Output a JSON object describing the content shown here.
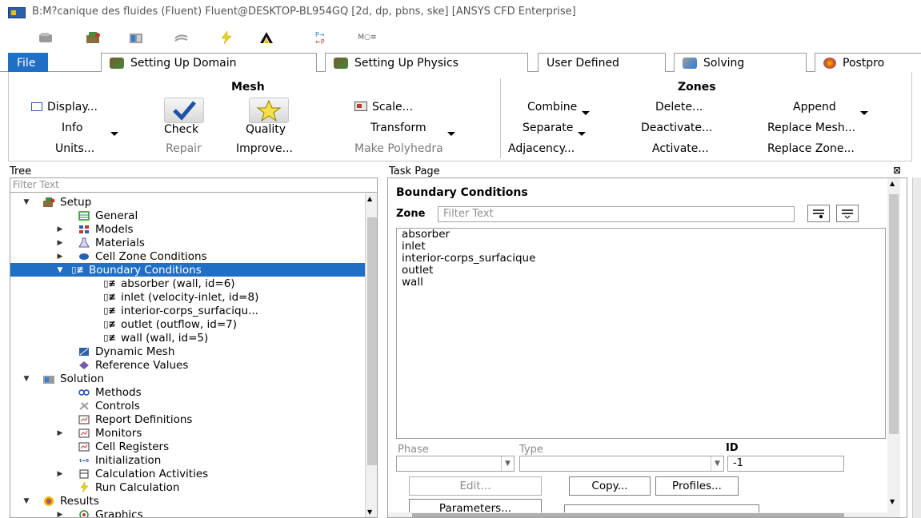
{
  "window": {
    "title": "B:M?canique des fluides (Fluent) Fluent@DESKTOP-BL954GQ  [2d, dp, pbns, ske] [ANSYS CFD Enterprise]"
  },
  "quick_toolbar": {
    "icons": [
      "open-case-icon",
      "read-case-icon",
      "write-case-icon",
      "undo-icon",
      "lightning-icon",
      "ansys-logo-icon",
      "parallel-icon",
      "mesh-info-icon"
    ],
    "mesh_label": "M○≡"
  },
  "ribbon_tabs": [
    {
      "label": "File"
    },
    {
      "label": "Setting Up Domain"
    },
    {
      "label": "Setting Up Physics"
    },
    {
      "label": "User Defined"
    },
    {
      "label": "Solving"
    },
    {
      "label": "Postpro"
    }
  ],
  "ribbon": {
    "mesh_group": {
      "title": "Mesh",
      "display": "Display...",
      "info": "Info",
      "units": "Units...",
      "check": "Check",
      "repair": "Repair",
      "quality": "Quality",
      "improve": "Improve...",
      "scale": "Scale...",
      "transform": "Transform",
      "make_polyhedra": "Make Polyhedra"
    },
    "zones_group": {
      "title": "Zones",
      "combine": "Combine",
      "separate": "Separate",
      "adjacency": "Adjacency...",
      "delete": "Delete...",
      "deactivate": "Deactivate...",
      "activate": "Activate...",
      "append": "Append",
      "replace_mesh": "Replace Mesh...",
      "replace_zone": "Replace Zone..."
    }
  },
  "tree": {
    "header": "Tree",
    "filter_placeholder": "Filter Text",
    "items": [
      {
        "label": "Setup"
      },
      {
        "label": "General"
      },
      {
        "label": "Models"
      },
      {
        "label": "Materials"
      },
      {
        "label": "Cell Zone Conditions"
      },
      {
        "label": "Boundary Conditions"
      },
      {
        "label": "absorber (wall, id=6)"
      },
      {
        "label": "inlet (velocity-inlet, id=8)"
      },
      {
        "label": "interior-corps_surfaciqu..."
      },
      {
        "label": "outlet (outflow, id=7)"
      },
      {
        "label": "wall (wall, id=5)"
      },
      {
        "label": "Dynamic Mesh"
      },
      {
        "label": "Reference Values"
      },
      {
        "label": "Solution"
      },
      {
        "label": "Methods"
      },
      {
        "label": "Controls"
      },
      {
        "label": "Report Definitions"
      },
      {
        "label": "Monitors"
      },
      {
        "label": "Cell Registers"
      },
      {
        "label": "Initialization"
      },
      {
        "label": "Calculation Activities"
      },
      {
        "label": "Run Calculation"
      },
      {
        "label": "Results"
      },
      {
        "label": "Graphics"
      }
    ]
  },
  "task_page": {
    "header": "Task Page",
    "close_glyph": "⊠",
    "title": "Boundary Conditions",
    "zone_label": "Zone",
    "zone_filter_placeholder": "Filter Text",
    "zones": [
      "absorber",
      "inlet",
      "interior-corps_surfacique",
      "outlet",
      "wall"
    ],
    "phase_label": "Phase",
    "type_label": "Type",
    "id_label": "ID",
    "id_value": "-1",
    "edit_button": "Edit...",
    "copy_button": "Copy...",
    "profiles_button": "Profiles...",
    "parameters_button": "Parameters..."
  }
}
